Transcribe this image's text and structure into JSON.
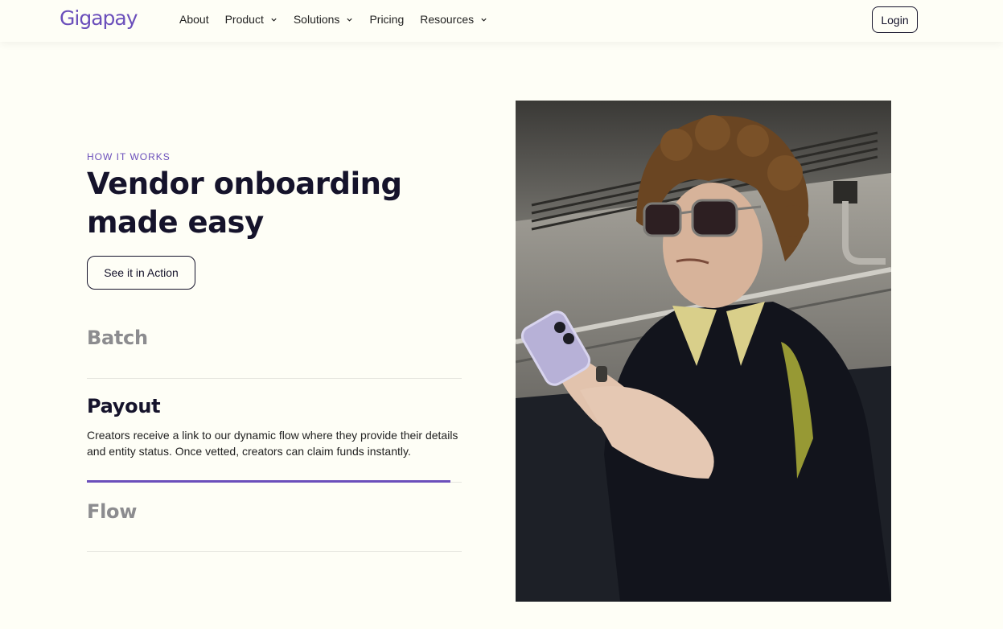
{
  "header": {
    "logo_text": "Gigapay",
    "nav": [
      {
        "label": "About",
        "has_dropdown": false
      },
      {
        "label": "Product",
        "has_dropdown": true
      },
      {
        "label": "Solutions",
        "has_dropdown": true
      },
      {
        "label": "Pricing",
        "has_dropdown": false
      },
      {
        "label": "Resources",
        "has_dropdown": true
      }
    ],
    "login_label": "Login"
  },
  "hero": {
    "eyebrow": "HOW IT WORKS",
    "title": "Vendor onboarding made easy",
    "cta_label": "See it in Action"
  },
  "steps": [
    {
      "title": "Batch",
      "active": false
    },
    {
      "title": "Payout",
      "active": true,
      "description": "Creators receive a link to our dynamic flow where they provide their details and entity status. Once vetted, creators can claim funds instantly.",
      "progress": 0.97
    },
    {
      "title": "Flow",
      "active": false
    }
  ],
  "colors": {
    "brand": "#6b4fbb",
    "text": "#15132b",
    "background": "#fefef6",
    "muted": "#8c8c8f"
  },
  "icons": {
    "dropdown": "chevron-down-icon"
  }
}
